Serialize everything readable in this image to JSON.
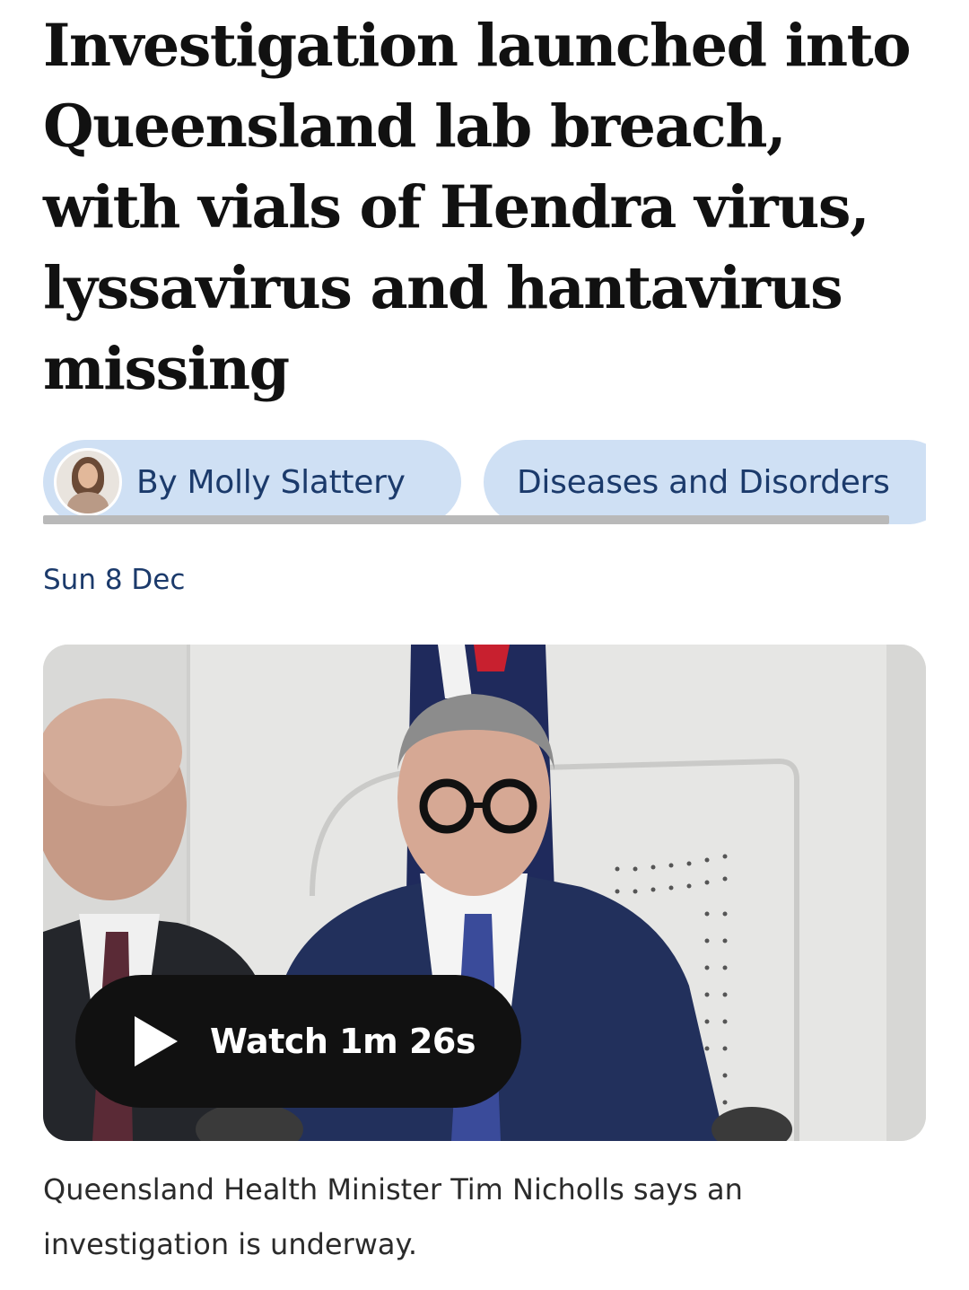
{
  "article": {
    "headline": "Investigation launched into Queensland lab breach, with vials of Hendra virus, lyssavirus and hantavirus missing",
    "byline": "By Molly Slattery",
    "topic": "Diseases and Disorders",
    "date": "Sun 8 Dec"
  },
  "video": {
    "watch_label": "Watch 1m 26s",
    "caption": "Queensland Health Minister Tim Nicholls says an investigation is underway."
  },
  "colors": {
    "chip_background": "#cfe0f4",
    "chip_text": "#1b3a6b",
    "watch_button": "#111111"
  },
  "icons": [
    "author-avatar",
    "play-icon"
  ]
}
